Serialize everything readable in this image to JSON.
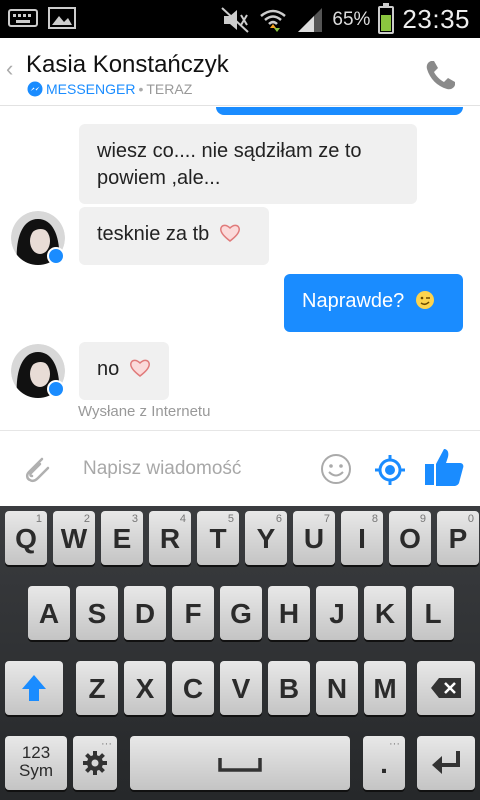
{
  "status_bar": {
    "battery_percent": "65%",
    "battery_level": 0.65,
    "time": "23:35"
  },
  "header": {
    "contact_name": "Kasia Konstańczyk",
    "app_label": "MESSENGER",
    "separator": "•",
    "last_active": "TERAZ"
  },
  "messages": [
    {
      "direction": "in",
      "text_line1": "wiesz co.... nie sądziłam ze to",
      "text_line2": "powiem ,ale..."
    },
    {
      "direction": "in",
      "text": "tesknie za tb",
      "emoji": "heart"
    },
    {
      "direction": "out",
      "text": "Naprawde?",
      "emoji": "wink"
    },
    {
      "direction": "in",
      "text": "no",
      "emoji": "heart"
    }
  ],
  "sent_via": "Wysłane z Internetu",
  "composer": {
    "placeholder": "Napisz wiadomość"
  },
  "keyboard": {
    "row1": [
      {
        "l": "Q",
        "s": "1"
      },
      {
        "l": "W",
        "s": "2"
      },
      {
        "l": "E",
        "s": "3"
      },
      {
        "l": "R",
        "s": "4"
      },
      {
        "l": "T",
        "s": "5"
      },
      {
        "l": "Y",
        "s": "6"
      },
      {
        "l": "U",
        "s": "7"
      },
      {
        "l": "I",
        "s": "8"
      },
      {
        "l": "O",
        "s": "9"
      },
      {
        "l": "P",
        "s": "0"
      }
    ],
    "row2": [
      "A",
      "S",
      "D",
      "F",
      "G",
      "H",
      "J",
      "K",
      "L"
    ],
    "row3": [
      "Z",
      "X",
      "C",
      "V",
      "B",
      "N",
      "M"
    ],
    "sym_label_1": "123",
    "sym_label_2": "Sym",
    "period": "."
  },
  "colors": {
    "accent": "#1a8cff",
    "bubble_in": "#f0f0f0",
    "heart": "#f28b8b"
  }
}
